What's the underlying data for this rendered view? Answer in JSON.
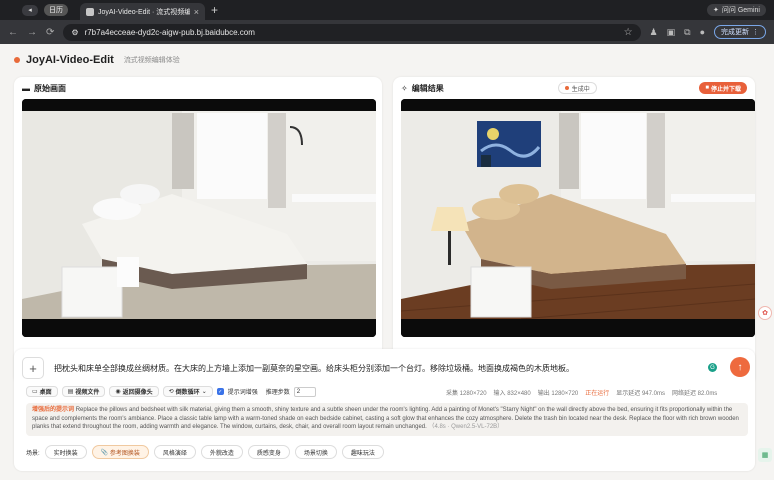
{
  "browser": {
    "tab_group": "日历",
    "tab_title": "JoyAI-Video-Edit · 流式视频编",
    "url": "r7b7a4ecceae-dyd2c-aigw-pub.bj.baidubce.com",
    "gemini": "问问 Gemini",
    "update": "完成更新"
  },
  "app": {
    "name": "JoyAI-Video-Edit",
    "subtitle": "流式视频编辑体验"
  },
  "panels": {
    "original_title": "原始画面",
    "result_title": "编辑结果",
    "status": "生成中",
    "stop_label": "停止并下载"
  },
  "prompt": {
    "text": "把枕头和床单全部换成丝绸材质。在大床的上方墙上添加一副莫奈的星空画。给床头柜分别添加一个台灯。移除垃圾桶。地面换成褐色的木质地板。",
    "send": "↑"
  },
  "toolbar": {
    "screen": "桌面",
    "video_file": "视频文件",
    "camera": "返回摄像头",
    "loop": "倒数循环",
    "show_enhance": "提示词增强",
    "steps_label": "推理步数",
    "steps_value": "2"
  },
  "stats": {
    "capture": "采集 1280×720",
    "input": "输入 832×480",
    "output": "输出 1280×720",
    "running": "正在运行",
    "display_latency": "显示延迟 947.0ms",
    "network_latency": "网络延迟 82.0ms"
  },
  "enhanced": {
    "label": "增强后的提示词",
    "text": "Replace the pillows and bedsheet with silk material, giving them a smooth, shiny texture and a subtle sheen under the room's lighting. Add a painting of Monet's \"Starry Night\" on the wall directly above the bed, ensuring it fits proportionally within the space and complements the room's ambiance. Place a classic table lamp with a warm-toned shade on each bedside cabinet, casting a soft glow that enhances the cozy atmosphere. Delete the trash bin located near the desk. Replace the floor with rich brown wooden planks that extend throughout the room, adding warmth and elegance. The window, curtains, desk, chair, and overall room layout remain unchanged.",
    "meta": "（4.8s · Qwen2.5-VL-72B）"
  },
  "scenes": {
    "label": "场景:",
    "items": [
      "实时换装",
      "参考图换装",
      "风格演绎",
      "外貌改造",
      "质感变身",
      "场景切换",
      "趣味玩法"
    ],
    "active_index": 1
  },
  "colors": {
    "accent": "#e86a3a",
    "page_bg": "#f5f4f2"
  }
}
